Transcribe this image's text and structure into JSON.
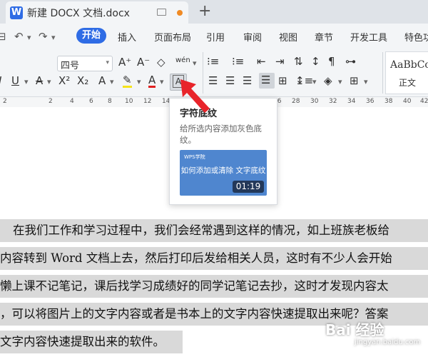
{
  "tab": {
    "title": "新建 DOCX 文档.docx",
    "icon": "W"
  },
  "menu": {
    "items": [
      "开始",
      "插入",
      "页面布局",
      "引用",
      "审阅",
      "视图",
      "章节",
      "开发工具",
      "特色功"
    ]
  },
  "ribbon": {
    "font_size": "四号",
    "font_size_arrow": "▾",
    "styles_sample": "AaBbCcI",
    "styles_name": "正文",
    "buttons": {
      "grow_font": "A⁺",
      "shrink_font": "A⁻",
      "clear_format": "◇",
      "pinyin": "wén",
      "underline": "U",
      "strikethrough": "A",
      "superscript": "X²",
      "subscript": "X₂",
      "text_effect": "A",
      "highlight": "✎",
      "font_color": "A",
      "shading": "A"
    }
  },
  "ruler": {
    "ticks": [
      "2",
      "2",
      "4",
      "6",
      "8",
      "10",
      "12",
      "14",
      "16",
      "18",
      "20",
      "22",
      "24",
      "26",
      "28",
      "30",
      "32",
      "34",
      "36",
      "38",
      "40",
      "42"
    ]
  },
  "tooltip": {
    "title": "字符底纹",
    "desc": "给所选内容添加灰色底纹。",
    "video_brand": "WPS学院",
    "video_caption": "如何添加或清除 文字底纹",
    "video_time": "01:19"
  },
  "document": {
    "lines": [
      "在我们工作和学习过程中，我们会经常遇到这样的情况，如上班族老板给",
      "内容转到 Word 文档上去，然后打印后发给相关人员，这时有不少人会开始",
      "懒上课不记笔记，课后找学习成绩好的同学记笔记去抄，这时才发现内容太",
      "，可以将图片上的文字内容或者是书本上的文字内容快速提取出来呢？答案",
      "文字内容快速提取出来的软件。"
    ]
  },
  "watermark": {
    "main": "Bai 经验",
    "sub": "jingyan.baidu.com"
  },
  "colors": {
    "accent": "#2f6ce5",
    "arrow": "#e8242a",
    "shading": "#d9d9d9"
  }
}
